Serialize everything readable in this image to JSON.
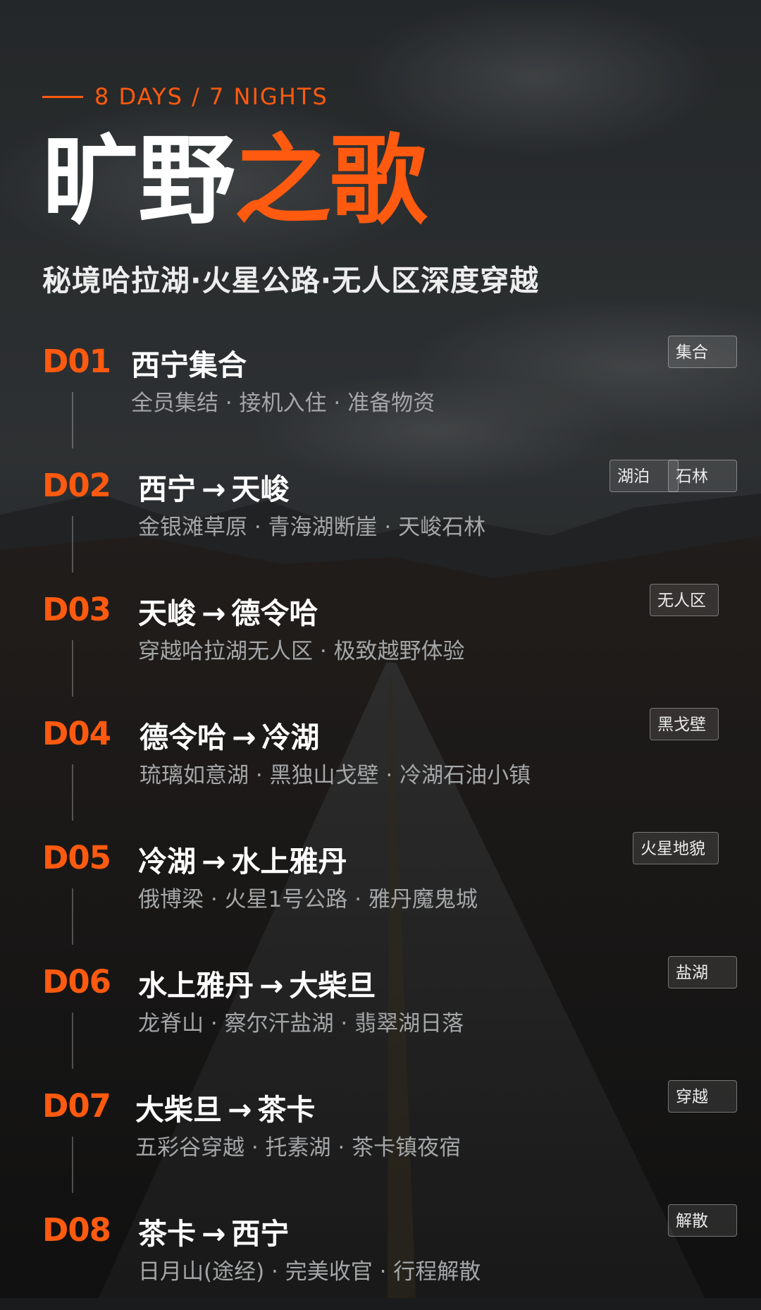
{
  "kicker": "8 DAYS / 7 NIGHTS",
  "title": {
    "part1": "旷野",
    "part2": "之歌"
  },
  "subtitle": "秘境哈拉湖·火星公路·无人区深度穿越",
  "arrow_glyph": "→",
  "days": [
    {
      "num": "D01",
      "from": "西宁集合",
      "to": "",
      "desc": "全员集结 · 接机入住 · 准备物资",
      "tags": [
        "集合"
      ]
    },
    {
      "num": "D02",
      "from": "西宁",
      "to": "天峻",
      "desc": "金银滩草原 · 青海湖断崖 · 天峻石林",
      "tags": [
        "湖泊",
        "石林"
      ]
    },
    {
      "num": "D03",
      "from": "天峻",
      "to": "德令哈",
      "desc": "穿越哈拉湖无人区 · 极致越野体验",
      "tags": [
        "无人区"
      ]
    },
    {
      "num": "D04",
      "from": "德令哈",
      "to": "冷湖",
      "desc": "琉璃如意湖 · 黑独山戈壁 · 冷湖石油小镇",
      "tags": [
        "黑戈壁"
      ]
    },
    {
      "num": "D05",
      "from": "冷湖",
      "to": "水上雅丹",
      "desc": "俄博梁 · 火星1号公路 · 雅丹魔鬼城",
      "tags": [
        "火星地貌"
      ]
    },
    {
      "num": "D06",
      "from": "水上雅丹",
      "to": "大柴旦",
      "desc": "龙脊山 · 察尔汗盐湖 · 翡翠湖日落",
      "tags": [
        "盐湖"
      ]
    },
    {
      "num": "D07",
      "from": "大柴旦",
      "to": "茶卡",
      "desc": "五彩谷穿越 · 托素湖 · 茶卡镇夜宿",
      "tags": [
        "穿越"
      ]
    },
    {
      "num": "D08",
      "from": "茶卡",
      "to": "西宁",
      "desc": "日月山(途经) · 完美收官 · 行程解散",
      "tags": [
        "解散"
      ]
    }
  ],
  "colors": {
    "accent": "#ff5a0f",
    "text_primary": "#ffffff",
    "text_secondary": "#a4a6a8",
    "tag_bg": "rgba(255,255,255,0.10)"
  }
}
